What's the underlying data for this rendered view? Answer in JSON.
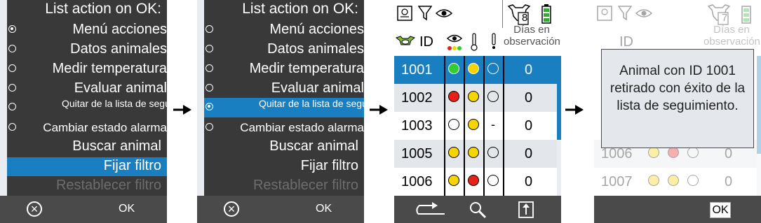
{
  "menu": {
    "title": "List action on OK:",
    "options": [
      {
        "label": "Menú acciones"
      },
      {
        "label": "Datos animales"
      },
      {
        "label": "Medir temperatura"
      },
      {
        "label": "Evaluar animal"
      },
      {
        "label": "Quitar de la lista de seguimiento"
      },
      {
        "label": "Cambiar estado alarma"
      }
    ],
    "actions": [
      {
        "label": "Buscar animal"
      },
      {
        "label": "Fijar filtro"
      },
      {
        "label": "Restablecer filtro"
      }
    ],
    "softkeys": {
      "cancel_icon": "cancel-icon",
      "ok": "OK"
    }
  },
  "screen2": {
    "selected_option_index": 4
  },
  "list": {
    "status_badge": "8",
    "columns": {
      "id": "ID",
      "days": "Días en observación"
    },
    "rows": [
      {
        "id": "1001",
        "s1": "green",
        "s2": "yellow",
        "s3": "empty",
        "days": "0"
      },
      {
        "id": "1002",
        "s1": "red",
        "s2": "yellow",
        "s3": "empty",
        "days": "0"
      },
      {
        "id": "1003",
        "s1": "empty",
        "s2": "yellow",
        "s3": "-",
        "days": "0"
      },
      {
        "id": "1005",
        "s1": "yellow",
        "s2": "yellow",
        "s3": "empty",
        "days": "0"
      },
      {
        "id": "1006",
        "s1": "yellow",
        "s2": "red",
        "s3": "empty",
        "days": "0"
      }
    ]
  },
  "popup": {
    "status_badge": "7",
    "message": "Animal con ID 1001 retirado con éxito de la lista de seguimiento.",
    "bg_rows": [
      {
        "id": "1006",
        "s1": "yellow",
        "s2": "red",
        "s3": "empty",
        "days": "0"
      },
      {
        "id": "1007",
        "s1": "yellow",
        "s2": "yellow",
        "s3": "empty",
        "days": "0"
      }
    ],
    "ok": "OK"
  },
  "colors": {
    "accent": "#1a7fc0",
    "dark": "#393939",
    "green": "#33cc33",
    "red": "#e8201a",
    "yellow": "#f6d400"
  }
}
